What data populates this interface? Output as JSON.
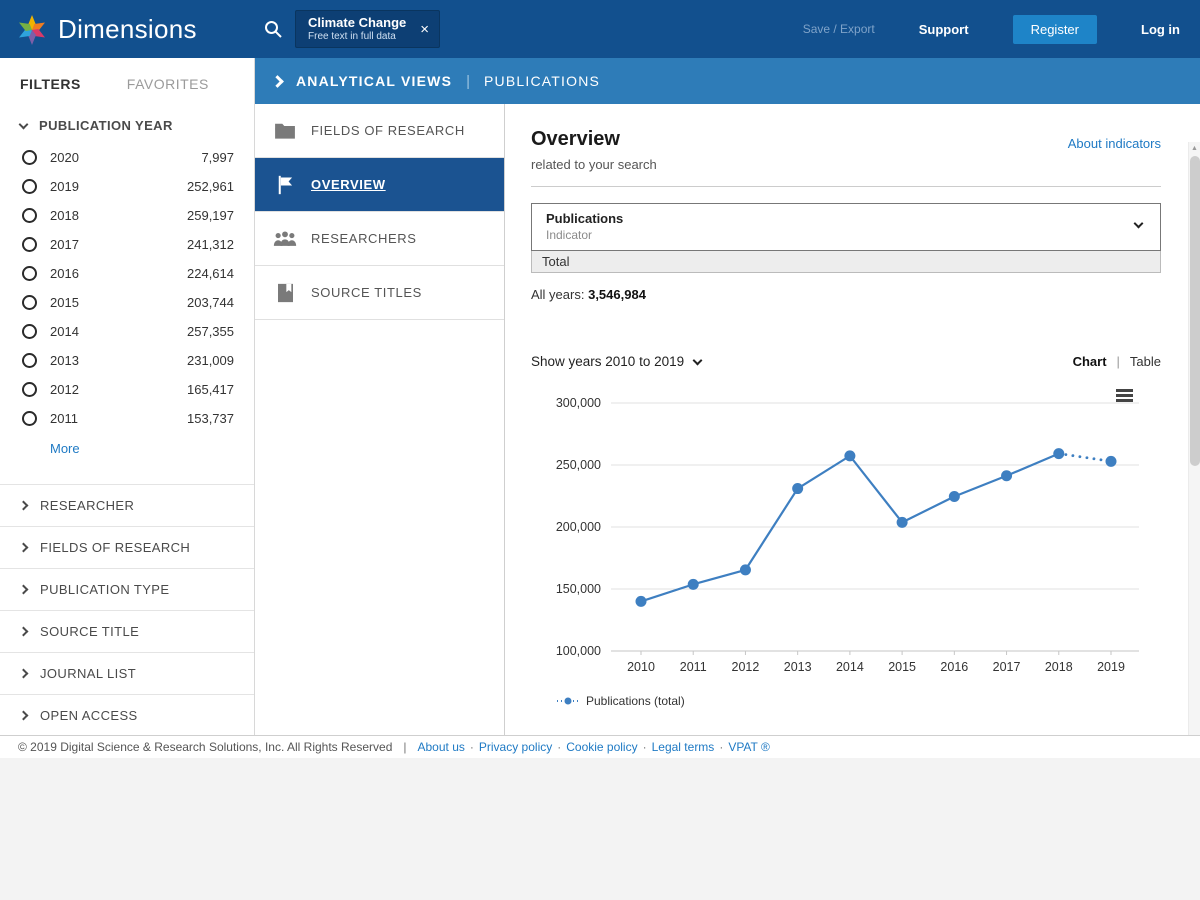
{
  "topbar": {
    "brand": "Dimensions",
    "search_chip": {
      "query": "Climate Change",
      "scope": "Free text in full data"
    },
    "save_export": "Save / Export",
    "support": "Support",
    "register": "Register",
    "login": "Log in"
  },
  "filters": {
    "tab_filters": "FILTERS",
    "tab_favorites": "FAVORITES",
    "publication_year": {
      "label": "PUBLICATION YEAR",
      "items": [
        {
          "year": "2020",
          "count": "7,997"
        },
        {
          "year": "2019",
          "count": "252,961"
        },
        {
          "year": "2018",
          "count": "259,197"
        },
        {
          "year": "2017",
          "count": "241,312"
        },
        {
          "year": "2016",
          "count": "224,614"
        },
        {
          "year": "2015",
          "count": "203,744"
        },
        {
          "year": "2014",
          "count": "257,355"
        },
        {
          "year": "2013",
          "count": "231,009"
        },
        {
          "year": "2012",
          "count": "165,417"
        },
        {
          "year": "2011",
          "count": "153,737"
        }
      ],
      "more": "More"
    },
    "sections": [
      "RESEARCHER",
      "FIELDS OF RESEARCH",
      "PUBLICATION TYPE",
      "SOURCE TITLE",
      "JOURNAL LIST",
      "OPEN ACCESS"
    ]
  },
  "view_header": {
    "title": "ANALYTICAL VIEWS",
    "divider": "|",
    "subtitle": "PUBLICATIONS"
  },
  "views_nav": {
    "items": [
      {
        "label": "FIELDS OF RESEARCH",
        "icon": "folder-icon",
        "selected": false
      },
      {
        "label": "OVERVIEW",
        "icon": "flag-icon",
        "selected": true
      },
      {
        "label": "RESEARCHERS",
        "icon": "people-icon",
        "selected": false
      },
      {
        "label": "SOURCE TITLES",
        "icon": "book-icon",
        "selected": false
      }
    ]
  },
  "overview": {
    "title": "Overview",
    "subtitle": "related to your search",
    "about_link": "About indicators",
    "indicator": {
      "value": "Publications",
      "label": "Indicator",
      "selected_option": "Total"
    },
    "all_years_label": "All years:",
    "all_years_value": "3,546,984",
    "show_years": "Show years 2010 to 2019",
    "toggle": {
      "chart": "Chart",
      "sep": "|",
      "table": "Table"
    },
    "legend": "Publications (total)"
  },
  "chart_data": {
    "type": "line",
    "title": "Publications per year",
    "x": [
      2010,
      2011,
      2012,
      2013,
      2014,
      2015,
      2016,
      2017,
      2018,
      2019
    ],
    "series": [
      {
        "name": "Publications (total)",
        "values": [
          140000,
          153737,
          165417,
          231009,
          257355,
          203744,
          224614,
          241312,
          259197,
          252961
        ]
      }
    ],
    "ylim": [
      100000,
      300000
    ],
    "ytick_step": 50000,
    "last_segment_dotted": true,
    "line_color": "#3e7fc1",
    "grid": true,
    "legend_position": "bottom-left"
  },
  "footer": {
    "copyright": "© 2019 Digital Science & Research Solutions, Inc. All Rights Reserved",
    "bar": "|",
    "links": [
      "About us",
      "Privacy policy",
      "Cookie policy",
      "Legal terms",
      "VPAT ®"
    ],
    "link_sep": "·"
  },
  "colors": {
    "topbar": "#12508e",
    "view_header": "#2e7cb8",
    "selected_nav": "#1b5391",
    "accent_link": "#1f7ac4",
    "chart_line": "#3e7fc1"
  }
}
